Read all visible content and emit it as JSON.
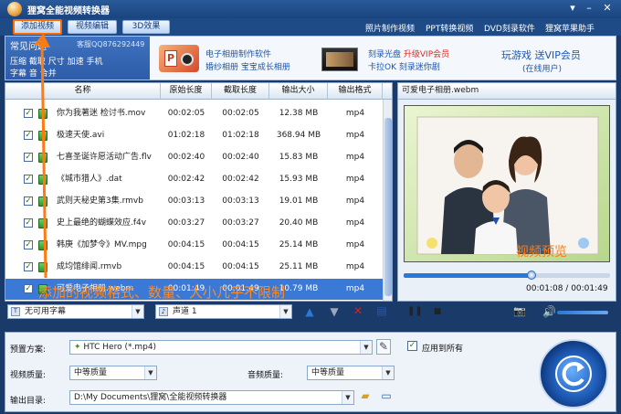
{
  "app": {
    "title": "狸窝全能视频转换器"
  },
  "toolbar": {
    "add_video": "添加视频",
    "video_edit": "视频编辑",
    "effect_3d": "3D效果",
    "links": [
      "照片制作视频",
      "PPT转换视频",
      "DVD刻录软件",
      "狸窝苹果助手"
    ]
  },
  "banner": {
    "faq_title": "常见问题",
    "faq_qq": "客服QQ876292449",
    "faq_row1": "压缩  截取  尺寸  加速  手机",
    "faq_row2": "字幕  音  合并",
    "promo1_line1": "电子相册制作软件",
    "promo1_line2": "婚纱相册 宝宝成长相册",
    "promo2_line1": "刻录光盘",
    "promo2_line1_red": "升级VIP会员",
    "promo2_line2": "卡拉OK  刻录迷你剧",
    "promo3_line1": "玩游戏  送VIP会员",
    "promo3_line2": "(在线用户)"
  },
  "table": {
    "headers": [
      "名称",
      "原始长度",
      "截取长度",
      "输出大小",
      "输出格式"
    ],
    "rows": [
      {
        "name": "你为我著迷 检讨书.mov",
        "orig": "00:02:05",
        "clip": "00:02:05",
        "size": "12.38 MB",
        "fmt": "mp4",
        "selected": false
      },
      {
        "name": "极速天使.avi",
        "orig": "01:02:18",
        "clip": "01:02:18",
        "size": "368.94 MB",
        "fmt": "mp4",
        "selected": false
      },
      {
        "name": "七喜圣诞许愿活动广告.flv",
        "orig": "00:02:40",
        "clip": "00:02:40",
        "size": "15.83 MB",
        "fmt": "mp4",
        "selected": false
      },
      {
        "name": "《城市猎人》.dat",
        "orig": "00:02:42",
        "clip": "00:02:42",
        "size": "15.93 MB",
        "fmt": "mp4",
        "selected": false
      },
      {
        "name": "武则天秘史第3集.rmvb",
        "orig": "00:03:13",
        "clip": "00:03:13",
        "size": "19.01 MB",
        "fmt": "mp4",
        "selected": false
      },
      {
        "name": "史上最绝的蝴蝶效应.f4v",
        "orig": "00:03:27",
        "clip": "00:03:27",
        "size": "20.40 MB",
        "fmt": "mp4",
        "selected": false
      },
      {
        "name": "韩庚《加梦令》MV.mpg",
        "orig": "00:04:15",
        "clip": "00:04:15",
        "size": "25.14 MB",
        "fmt": "mp4",
        "selected": false
      },
      {
        "name": "成均馆绯闻.rmvb",
        "orig": "00:04:15",
        "clip": "00:04:15",
        "size": "25.11 MB",
        "fmt": "mp4",
        "selected": false
      },
      {
        "name": "可爱电子相册.webm",
        "orig": "00:01:49",
        "clip": "00:01:49",
        "size": "10.79 MB",
        "fmt": "mp4",
        "selected": true
      }
    ]
  },
  "overlay": {
    "caption": "添加的视频格式、数量、大小几乎不限制"
  },
  "controls": {
    "subtitle": "无可用字幕",
    "audio": "声道 1"
  },
  "preview": {
    "title": "可爱电子相册.webm",
    "caption": "视频预览",
    "current": "00:01:08",
    "total": "00:01:49",
    "progress": 0.62
  },
  "bottom": {
    "preset_label": "预置方案:",
    "preset_value": "HTC Hero (*.mp4)",
    "apply_all": "应用到所有",
    "video_quality_label": "视频质量:",
    "video_quality": "中等质量",
    "audio_quality_label": "音频质量:",
    "audio_quality": "中等质量",
    "output_dir_label": "输出目录:",
    "output_dir": "D:\\My Documents\\狸窝\\全能视频转换器"
  }
}
